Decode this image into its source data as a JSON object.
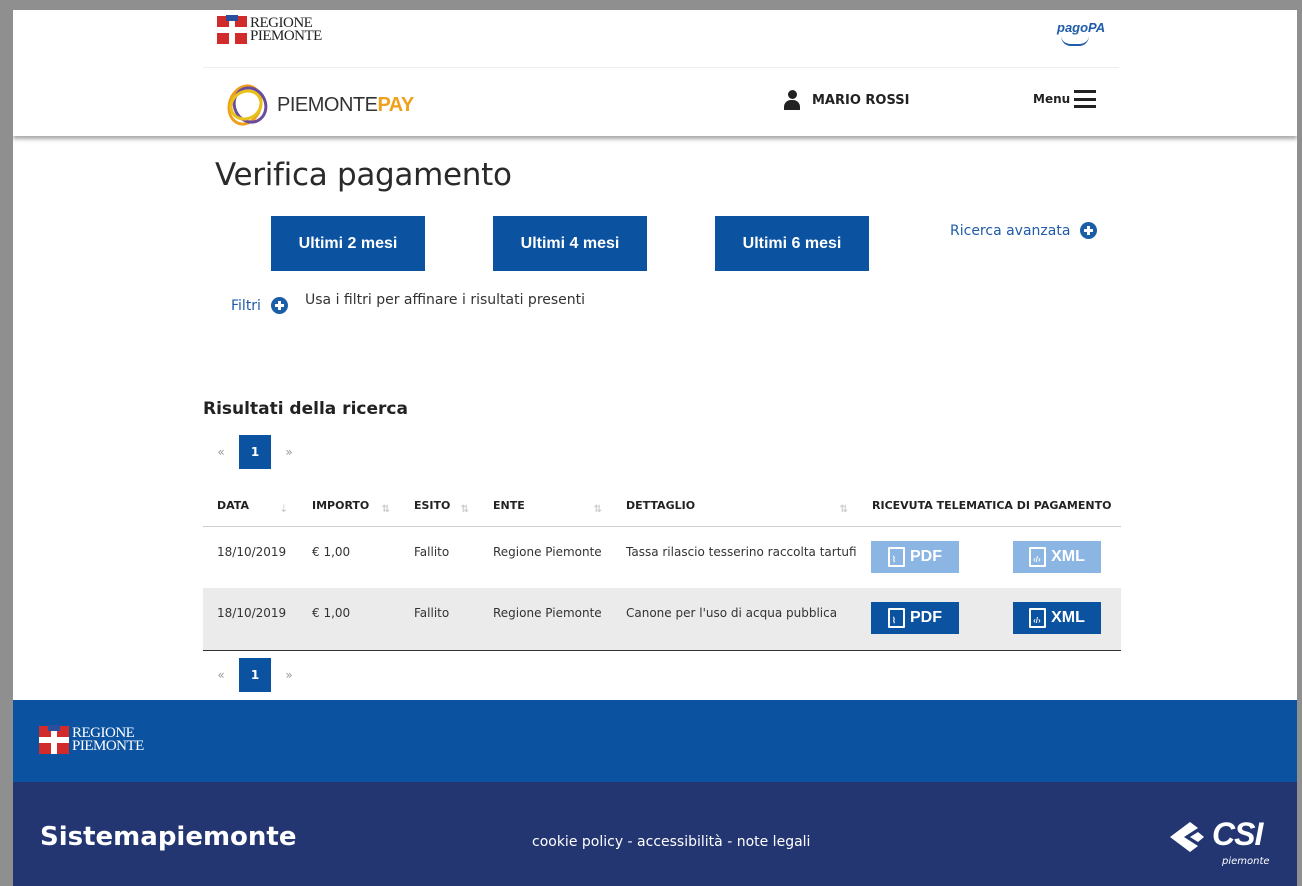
{
  "header": {
    "region_logo_line1": "REGIONE",
    "region_logo_line2": "PIEMONTE",
    "pagopa_logo": "pagoPA",
    "app_logo_part1": "PIEMONTE",
    "app_logo_part2": "PAY",
    "user_name": "MARIO ROSSI",
    "menu_label": "Menu"
  },
  "main": {
    "title": "Verifica pagamento",
    "range_buttons": [
      "Ultimi 2 mesi",
      "Ultimi 4 mesi",
      "Ultimi 6 mesi"
    ],
    "advanced_search": "Ricerca avanzata",
    "filters_label": "Filtri",
    "filters_hint": "Usa i filtri per affinare i risultati presenti",
    "results_title": "Risultati della ricerca",
    "pager": {
      "prev": "«",
      "current": "1",
      "next": "»"
    },
    "table": {
      "headers": [
        "DATA",
        "IMPORTO",
        "ESITO",
        "ENTE",
        "DETTAGLIO",
        "RICEVUTA TELEMATICA DI PAGAMENTO"
      ],
      "rows": [
        {
          "data": "18/10/2019",
          "importo": "€ 1,00",
          "esito": "Fallito",
          "ente": "Regione Piemonte",
          "dettaglio": "Tassa rilascio tesserino raccolta tartufi",
          "pdf": "PDF",
          "xml": "XML"
        },
        {
          "data": "18/10/2019",
          "importo": "€ 1,00",
          "esito": "Fallito",
          "ente": "Regione Piemonte",
          "dettaglio": "Canone per l'uso di acqua pubblica",
          "pdf": "PDF",
          "xml": "XML"
        }
      ]
    }
  },
  "footer": {
    "region_logo_line1": "REGIONE",
    "region_logo_line2": "PIEMONTE",
    "brand": "Sistemapiemonte",
    "links": "cookie policy - accessibilità - note legali",
    "csi_logo": "CSI",
    "csi_sub": "piemonte"
  },
  "colors": {
    "primary": "#0b52a0",
    "primary_light": "#8bb6e3",
    "footer_dark": "#233672",
    "accent": "#f0a11c"
  },
  "icons": [
    "user-icon",
    "hamburger-icon",
    "plus-circle-icon",
    "sort-icon",
    "pdf-file-icon",
    "xml-file-icon"
  ]
}
